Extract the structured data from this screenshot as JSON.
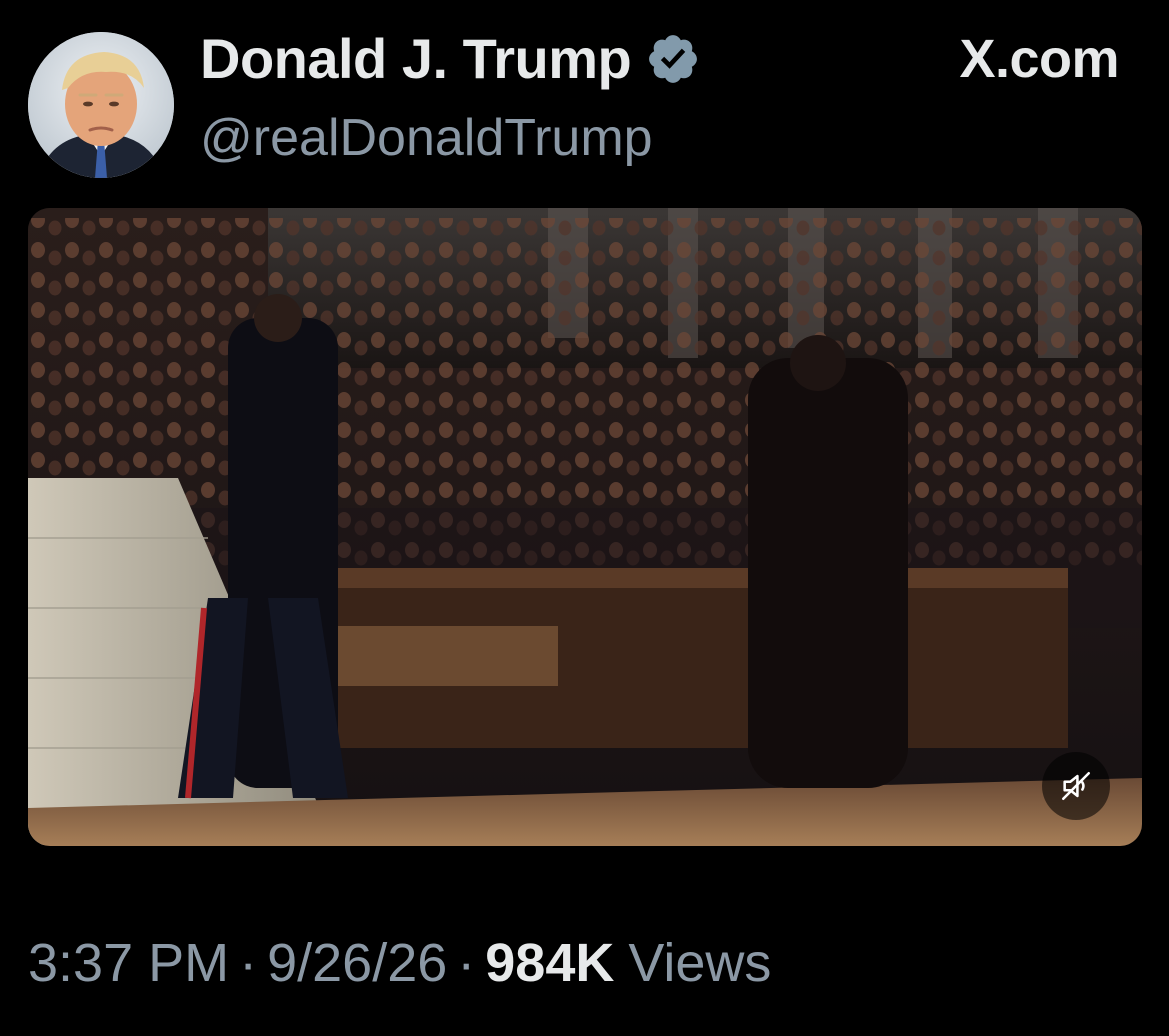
{
  "post": {
    "author": {
      "display_name": "Donald J. Trump",
      "handle": "@realDonaldTrump",
      "verified": true,
      "verified_color": "#829aab"
    },
    "brand": "X.com",
    "media": {
      "type": "video",
      "muted": true,
      "mute_icon": "speaker-muted-icon"
    },
    "meta": {
      "time": "3:37 PM",
      "separator": "·",
      "date": "9/26/26",
      "views_count": "984K",
      "views_label": "Views"
    }
  },
  "colors": {
    "background": "#000000",
    "primary_text": "#e7e9ea",
    "secondary_text": "#8b98a5"
  }
}
